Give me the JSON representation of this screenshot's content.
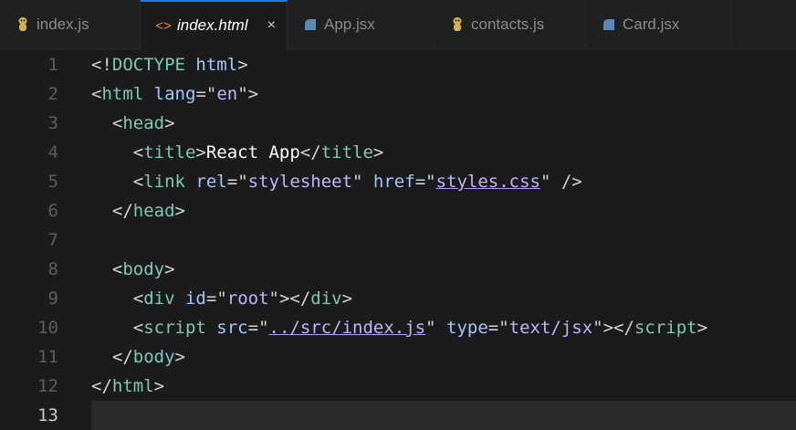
{
  "tabs": [
    {
      "label": "index.js",
      "icon": "js-file-icon",
      "active": false
    },
    {
      "label": "index.html",
      "icon": "html-file-icon",
      "active": true,
      "close": "×"
    },
    {
      "label": "App.jsx",
      "icon": "jsx-file-icon",
      "active": false
    },
    {
      "label": "contacts.js",
      "icon": "js-file-icon",
      "active": false
    },
    {
      "label": "Card.jsx",
      "icon": "jsx-file-icon",
      "active": false
    }
  ],
  "editor": {
    "current_line": 13,
    "lines": [
      {
        "n": "1",
        "tokens": [
          [
            "p",
            "<!"
          ],
          [
            "t",
            "DOCTYPE"
          ],
          [
            "p",
            " "
          ],
          [
            "a",
            "html"
          ],
          [
            "p",
            ">"
          ]
        ]
      },
      {
        "n": "2",
        "tokens": [
          [
            "p",
            "<"
          ],
          [
            "t",
            "html"
          ],
          [
            "p",
            " "
          ],
          [
            "a",
            "lang"
          ],
          [
            "p",
            "=\""
          ],
          [
            "s",
            "en"
          ],
          [
            "p",
            "\">"
          ]
        ]
      },
      {
        "n": "3",
        "tokens": [
          [
            "p",
            "  <"
          ],
          [
            "t",
            "head"
          ],
          [
            "p",
            ">"
          ]
        ]
      },
      {
        "n": "4",
        "tokens": [
          [
            "p",
            "    <"
          ],
          [
            "t",
            "title"
          ],
          [
            "p",
            ">"
          ],
          [
            "w",
            "React App"
          ],
          [
            "p",
            "</"
          ],
          [
            "t",
            "title"
          ],
          [
            "p",
            ">"
          ]
        ]
      },
      {
        "n": "5",
        "tokens": [
          [
            "p",
            "    <"
          ],
          [
            "t",
            "link"
          ],
          [
            "p",
            " "
          ],
          [
            "a",
            "rel"
          ],
          [
            "p",
            "=\""
          ],
          [
            "s",
            "stylesheet"
          ],
          [
            "p",
            "\" "
          ],
          [
            "a",
            "href"
          ],
          [
            "p",
            "=\""
          ],
          [
            "u",
            "styles.css"
          ],
          [
            "p",
            "\" />"
          ]
        ]
      },
      {
        "n": "6",
        "tokens": [
          [
            "p",
            "  </"
          ],
          [
            "t",
            "head"
          ],
          [
            "p",
            ">"
          ]
        ]
      },
      {
        "n": "7",
        "tokens": []
      },
      {
        "n": "8",
        "tokens": [
          [
            "p",
            "  <"
          ],
          [
            "t",
            "body"
          ],
          [
            "p",
            ">"
          ]
        ]
      },
      {
        "n": "9",
        "tokens": [
          [
            "p",
            "    <"
          ],
          [
            "t",
            "div"
          ],
          [
            "p",
            " "
          ],
          [
            "a",
            "id"
          ],
          [
            "p",
            "=\""
          ],
          [
            "s",
            "root"
          ],
          [
            "p",
            "\"></"
          ],
          [
            "t",
            "div"
          ],
          [
            "p",
            ">"
          ]
        ]
      },
      {
        "n": "10",
        "tokens": [
          [
            "p",
            "    <"
          ],
          [
            "t",
            "script"
          ],
          [
            "p",
            " "
          ],
          [
            "a",
            "src"
          ],
          [
            "p",
            "=\""
          ],
          [
            "u",
            "../src/index.js"
          ],
          [
            "p",
            "\" "
          ],
          [
            "a",
            "type"
          ],
          [
            "p",
            "=\""
          ],
          [
            "s",
            "text/jsx"
          ],
          [
            "p",
            "\"></"
          ],
          [
            "t",
            "script"
          ],
          [
            "p",
            ">"
          ]
        ]
      },
      {
        "n": "11",
        "tokens": [
          [
            "p",
            "  </"
          ],
          [
            "t",
            "body"
          ],
          [
            "p",
            ">"
          ]
        ]
      },
      {
        "n": "12",
        "tokens": [
          [
            "p",
            "</"
          ],
          [
            "t",
            "html"
          ],
          [
            "p",
            ">"
          ]
        ]
      },
      {
        "n": "13",
        "tokens": []
      }
    ]
  }
}
